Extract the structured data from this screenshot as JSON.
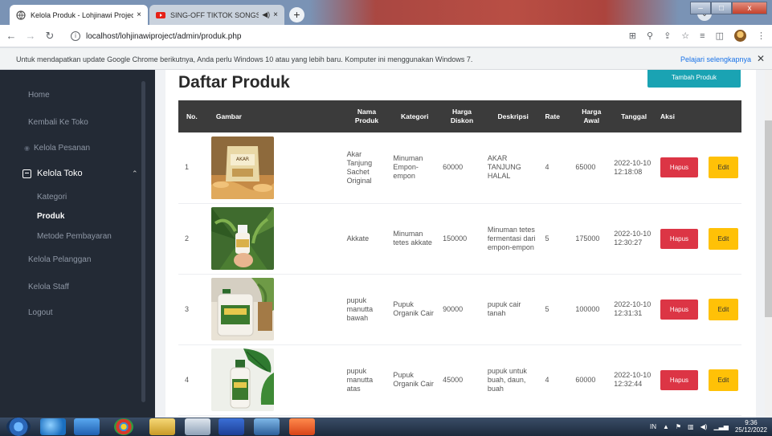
{
  "browser": {
    "tabs": [
      {
        "title": "Kelola Produk - Lohjinawi Project",
        "active": true
      },
      {
        "title": "SING-OFF TIKTOK SONGS PA",
        "active": false
      }
    ],
    "new_tab_label": "+",
    "close_label": "×",
    "address": "localhost/lohjinawiproject/admin/produk.php",
    "window_buttons": [
      "–",
      "□",
      "x"
    ],
    "profile_chip": "⌄"
  },
  "infobar": {
    "message": "Untuk mendapatkan update Google Chrome berikutnya, Anda perlu Windows 10 atau yang lebih baru. Komputer ini menggunakan Windows 7.",
    "link": "Pelajari selengkapnya",
    "close": "✕"
  },
  "sidebar": {
    "items": [
      {
        "label": "Home"
      },
      {
        "label": "Kembali Ke Toko"
      },
      {
        "label": "Kelola Pesanan"
      },
      {
        "label": "Kelola Toko"
      },
      {
        "label": "Kategori"
      },
      {
        "label": "Produk"
      },
      {
        "label": "Metode Pembayaran"
      },
      {
        "label": "Kelola Pelanggan"
      },
      {
        "label": "Kelola Staff"
      },
      {
        "label": "Logout"
      }
    ]
  },
  "page": {
    "title": "Daftar Produk",
    "add_button": "Tambah Produk"
  },
  "table": {
    "headers": {
      "no": "No.",
      "gambar": "Gambar",
      "nama": "Nama Produk",
      "kategori": "Kategori",
      "diskon": "Harga Diskon",
      "deskripsi": "Deskripsi",
      "rate": "Rate",
      "awal": "Harga Awal",
      "tanggal": "Tanggal",
      "aksi": "Aksi"
    },
    "rows": [
      {
        "no": "1",
        "nama": "Akar Tanjung Sachet Original",
        "kategori": "Minuman Empon-empon",
        "diskon": "60000",
        "deskripsi": "AKAR TANJUNG HALAL",
        "rate": "4",
        "awal": "65000",
        "tanggal": "2022-10-10 12:18:08",
        "hapus": "Hapus",
        "edit": "Edit"
      },
      {
        "no": "2",
        "nama": "Akkate",
        "kategori": "Minuman tetes akkate",
        "diskon": "150000",
        "deskripsi": "Minuman tetes fermentasi dari empon-empon",
        "rate": "5",
        "awal": "175000",
        "tanggal": "2022-10-10 12:30:27",
        "hapus": "Hapus",
        "edit": "Edit"
      },
      {
        "no": "3",
        "nama": "pupuk manutta bawah",
        "kategori": "Pupuk Organik Cair",
        "diskon": "90000",
        "deskripsi": "pupuk cair tanah",
        "rate": "5",
        "awal": "100000",
        "tanggal": "2022-10-10 12:31:31",
        "hapus": "Hapus",
        "edit": "Edit"
      },
      {
        "no": "4",
        "nama": "pupuk manutta atas",
        "kategori": "Pupuk Organik Cair",
        "diskon": "45000",
        "deskripsi": "pupuk untuk buah, daun, buah",
        "rate": "4",
        "awal": "60000",
        "tanggal": "2022-10-10 12:32:44",
        "hapus": "Hapus",
        "edit": "Edit"
      }
    ]
  },
  "taskbar": {
    "lang": "IN",
    "time": "9:36",
    "date": "25/12/2022"
  },
  "colors": {
    "sidebar": "#232a35",
    "header": "#3b3b3b",
    "accent": "#1aa3b3",
    "danger": "#dc3545",
    "warning": "#ffc107"
  }
}
